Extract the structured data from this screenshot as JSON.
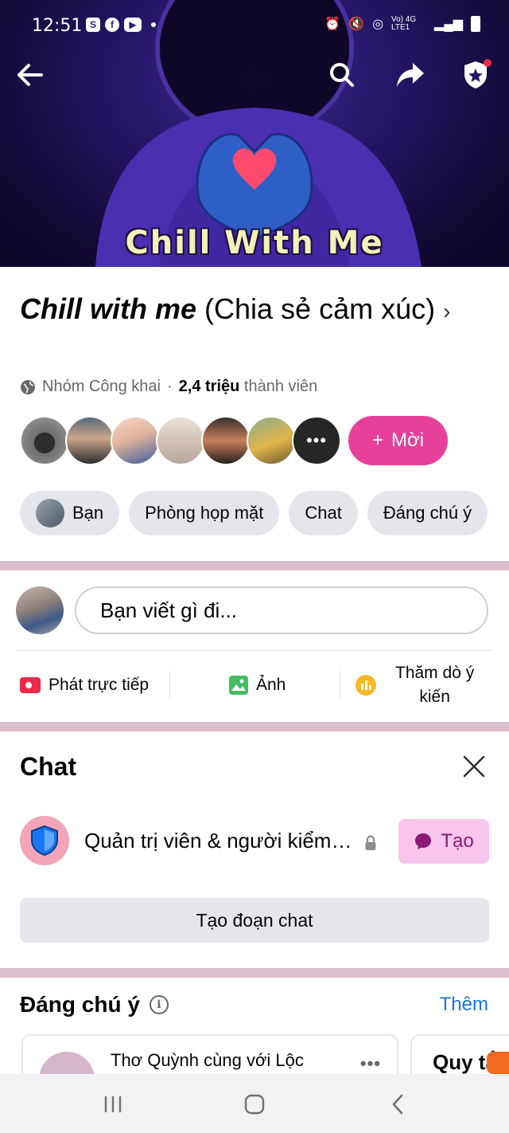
{
  "status_bar": {
    "time": "12:51",
    "network": "Vo) 4G LTE1"
  },
  "cover": {
    "title": "Chill  With Me",
    "colors": {
      "accent": "#2a1a6e",
      "heart": "#ff4a6e",
      "text": "#f4f1b8"
    }
  },
  "group": {
    "name_italic": "Chill with me",
    "name_rest": " (Chia sẻ cảm xúc)",
    "chevron": "›",
    "privacy": "Nhóm Công khai",
    "separator": "·",
    "member_count": "2,4 triệu",
    "member_label": " thành viên",
    "more_members": "•••",
    "invite_plus": "+",
    "invite_label": "Mời"
  },
  "chips": [
    "Bạn",
    "Phòng họp mặt",
    "Chat",
    "Đáng chú ý"
  ],
  "composer": {
    "placeholder": "Bạn viết gì đi...",
    "actions": {
      "live": "Phát trực tiếp",
      "photo": "Ảnh",
      "poll_line1": "Thăm dò ý",
      "poll_line2": "kiến"
    }
  },
  "chat": {
    "heading": "Chat",
    "item_name": "Quản trị viên & người kiểm duyệt",
    "create_label": "Tạo",
    "new_chat_label": "Tạo đoạn chat"
  },
  "featured": {
    "heading": "Đáng chú ý",
    "info_glyph": "i",
    "more_label": "Thêm",
    "card1_text": "Thơ Quỳnh cùng với Lộc",
    "card1_dots": "•••",
    "card2_text": "Quy tắ"
  },
  "colors": {
    "invite": "#e6409b",
    "link": "#1b74e4",
    "divider": "#dbbfcd",
    "create_bg": "#f7c5ed"
  }
}
